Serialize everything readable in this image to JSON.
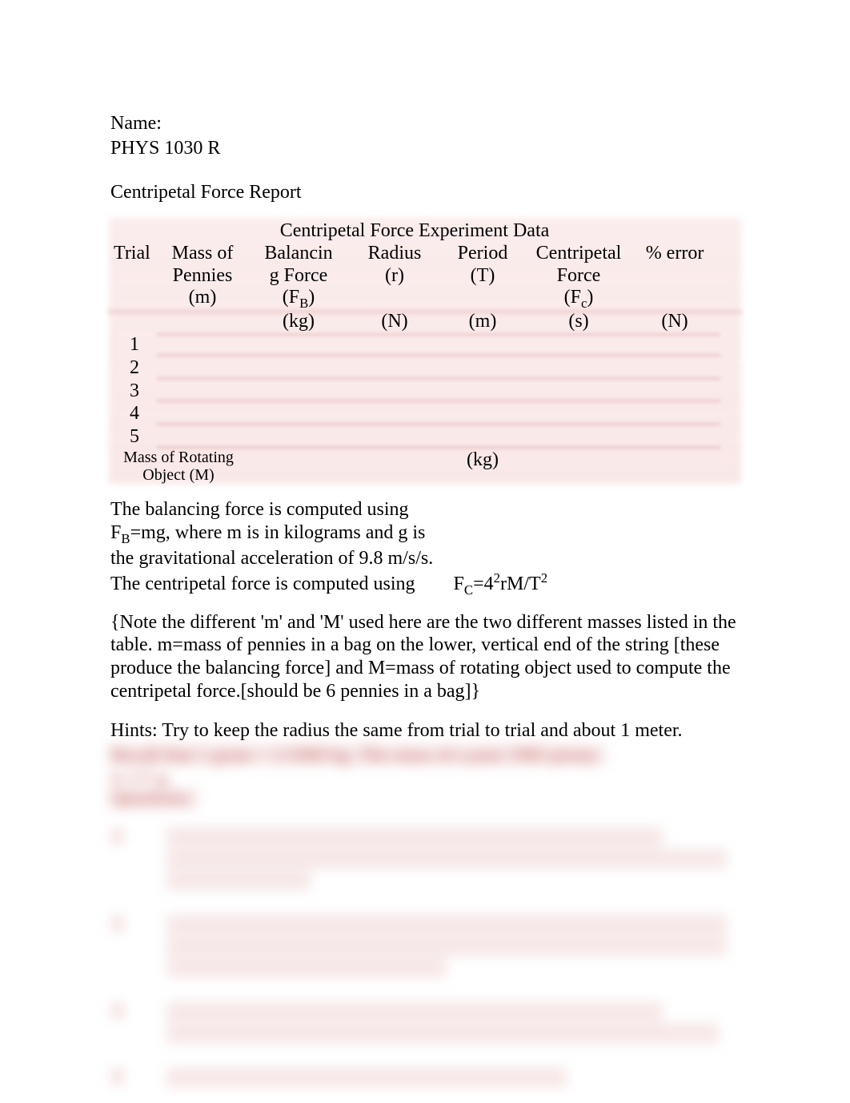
{
  "header": {
    "name_label": "Name:",
    "course": "PHYS 1030 R"
  },
  "title": "Centripetal Force Report",
  "table": {
    "caption": "Centripetal Force Experiment Data",
    "cols": {
      "trial": "Trial",
      "mass1": "Mass of",
      "mass2": "Pennies",
      "mass3": "(m)",
      "mass_unit": "(kg)",
      "bal1": "Balancin",
      "bal2": "g Force",
      "bal3a": "(F",
      "bal3b": "B",
      "bal3c": ")",
      "bal_unit": "(N)",
      "rad1": "Radius",
      "rad2": "(r)",
      "rad_unit": "(m)",
      "per1": "Period",
      "per2": "(T)",
      "per_unit": "(s)",
      "cen1": "Centripetal",
      "cen2": "Force",
      "cen3a": "(F",
      "cen3b": "c",
      "cen3c": ")",
      "cen_unit": "(N)",
      "err": "% error"
    },
    "trials": [
      "1",
      "2",
      "3",
      "4",
      "5"
    ],
    "footer": {
      "label1": "Mass of Rotating",
      "label2": "Object  (M) ",
      "unit": "(kg)"
    }
  },
  "body": {
    "p1a": "The balancing force is computed using",
    "p1b_a": "F",
    "p1b_b": "B",
    "p1b_c": "=mg,   where m is in kilograms and g is",
    "p2": "the gravitational acceleration of 9.8 m/s/s.",
    "p3a": "The centripetal force is computed using",
    "p3b_a": "F",
    "p3b_b": "C",
    "p3b_c": "=4",
    "p3b_d": "2",
    "p3b_e": "rM/T",
    "p3b_f": "2"
  },
  "note": {
    "l1": "{Note the different 'm' and 'M' used here are the two different masses listed in the",
    "l2": "table. m=mass of pennies in a bag on the lower, vertical end of the string [these",
    "l3": "produce the balancing force] and M=mass of rotating object used to compute the",
    "l4": "centripetal force.[should be 6 pennies in a bag]}"
  },
  "hints": "Hints:   Try to keep the radius the same from trial to trial and about 1 meter."
}
